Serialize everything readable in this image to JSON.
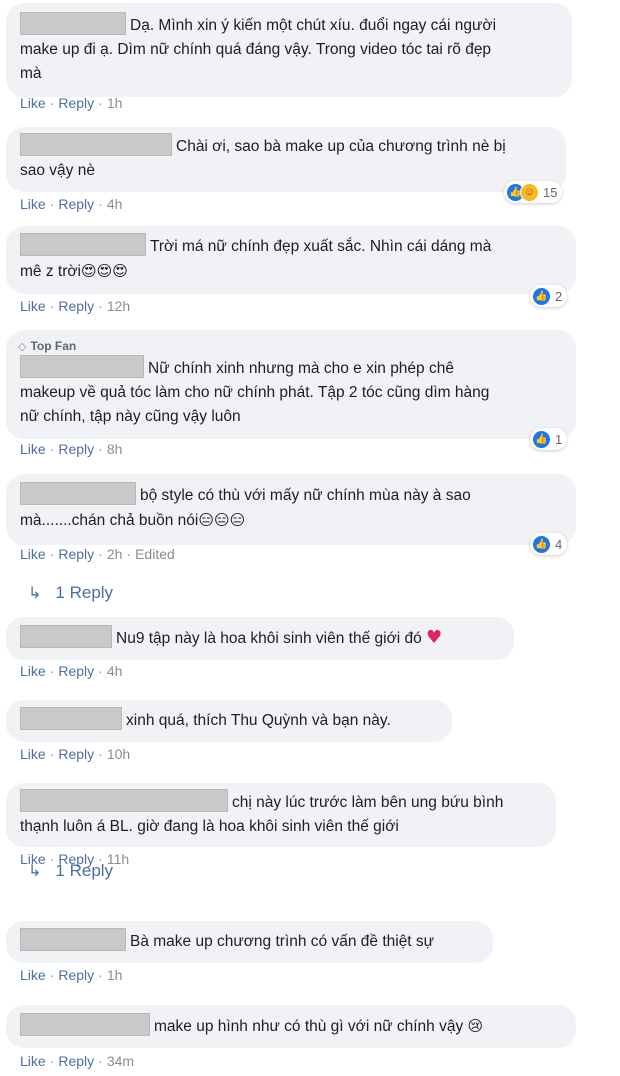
{
  "comments": [
    {
      "text1": "Dạ. Mình xin ý kiến một chút xíu. đuổi ngay cái người",
      "text2": "make up đi ạ. Dìm nữ chính quá đáng vậy. Trong video tóc tai rõ đẹp",
      "text3": "mà",
      "time": "1h"
    },
    {
      "text1": "Chài ơi, sao bà make up của chương trình nè bị",
      "text2": "sao vậy nè",
      "time": "4h",
      "reaction_count": "15"
    },
    {
      "text1": "Trời má nữ chính đẹp xuất sắc. Nhìn cái dáng mà",
      "text2": "mê z trời",
      "emoji": "😍😍😍",
      "time": "12h",
      "reaction_count": "2"
    },
    {
      "badge": "Top Fan",
      "text1": "Nữ chính xinh nhưng mà cho e xin phép chê",
      "text2": "makeup về quả tóc làm cho nữ chính phát. Tập 2 tóc cũng dìm hàng",
      "text3": "nữ chính, tập này cũng vậy luôn",
      "time": "8h",
      "reaction_count": "1"
    },
    {
      "text1": "bộ style có thù với mấy nữ chính mùa này à sao",
      "text2": "mà.......chán chả buồn nói",
      "emoji": "😑😑😑",
      "time": "2h",
      "edited": "Edited",
      "reaction_count": "4"
    },
    {
      "text1": "Nu9 tập này là hoa khôi sinh viên thế giới đó",
      "heart": "♥",
      "time": "4h"
    },
    {
      "text1": "xinh quá, thích Thu Quỳnh và bạn này.",
      "time": "10h"
    },
    {
      "text1": "chị này lúc trước làm bên ung bứu bình",
      "text2": "thạnh luôn á BL. giờ đang là hoa khôi sinh viên thế giới",
      "time": "11h"
    },
    {
      "text1": "Bà make up chương trình có vấn đề thiệt sự",
      "time": "1h"
    },
    {
      "text1": "make up hình như có thù gì với nữ chính vậy",
      "emoji": "😢",
      "time": "34m"
    }
  ],
  "labels": {
    "like": "Like",
    "reply": "Reply",
    "dot": "·"
  },
  "reply_links": [
    "1 Reply",
    "1 Reply"
  ],
  "icons": {
    "like": "thumbs-up-icon",
    "haha": "haha-icon",
    "reply_arrow": "reply-arrow-icon",
    "top_fan": "diamond-icon"
  },
  "colors": {
    "bubble": "#f0f2f5",
    "link": "#4b6ea7",
    "like_blue": "#1877f2",
    "heart": "#e0245e"
  }
}
